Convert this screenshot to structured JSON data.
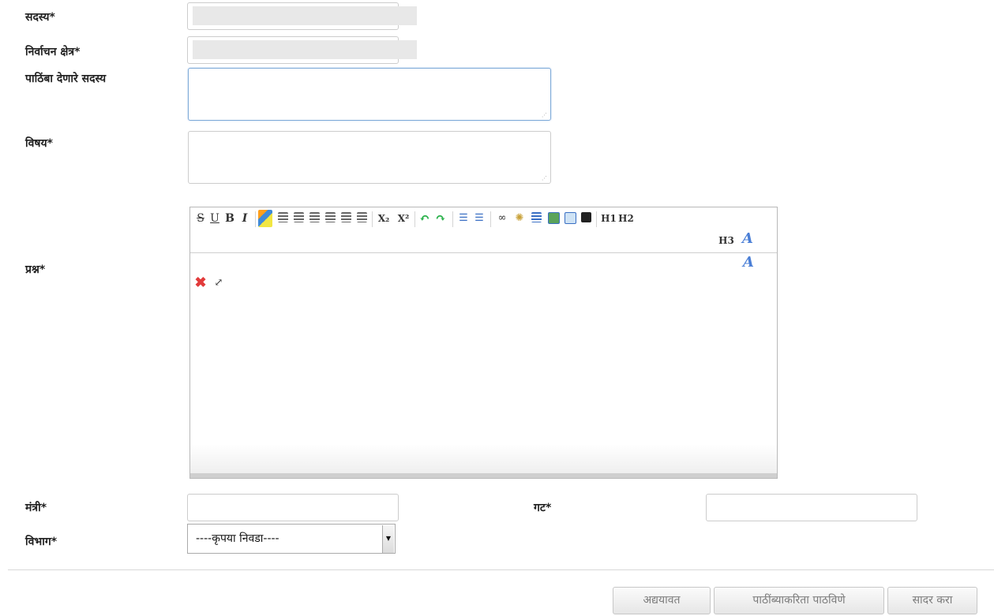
{
  "form": {
    "member_label": "सदस्य*",
    "constituency_label": "निर्वाचन क्षेत्र*",
    "supporting_members_label": "पाठिंबा देणारे सदस्य",
    "subject_label": "विषय*",
    "question_label": "प्रश्न*",
    "minister_label": "मंत्री*",
    "group_label": "गट*",
    "department_label": "विभाग*",
    "department_selected": "----कृपया निवडा----"
  },
  "editor": {
    "toolbar": [
      {
        "name": "strikethrough",
        "glyph": "S"
      },
      {
        "name": "underline",
        "glyph": "U"
      },
      {
        "name": "bold",
        "glyph": "B"
      },
      {
        "name": "italic",
        "glyph": "I"
      },
      {
        "name": "subscript",
        "glyph": "X₂"
      },
      {
        "name": "superscript",
        "glyph": "X²"
      },
      {
        "name": "heading1",
        "glyph": "H1"
      },
      {
        "name": "heading2",
        "glyph": "H2"
      },
      {
        "name": "heading3",
        "glyph": "H3"
      }
    ]
  },
  "buttons": {
    "update": "अद्ययावत",
    "send_for_support": "पाठींब्याकरिता पाठविणे",
    "submit": "सादर करा"
  },
  "colors": {
    "focus_border": "#7eaad8",
    "remove_red": "#e23b3b",
    "undo_green": "#2bb24c",
    "button_text": "#7a7a7a"
  }
}
